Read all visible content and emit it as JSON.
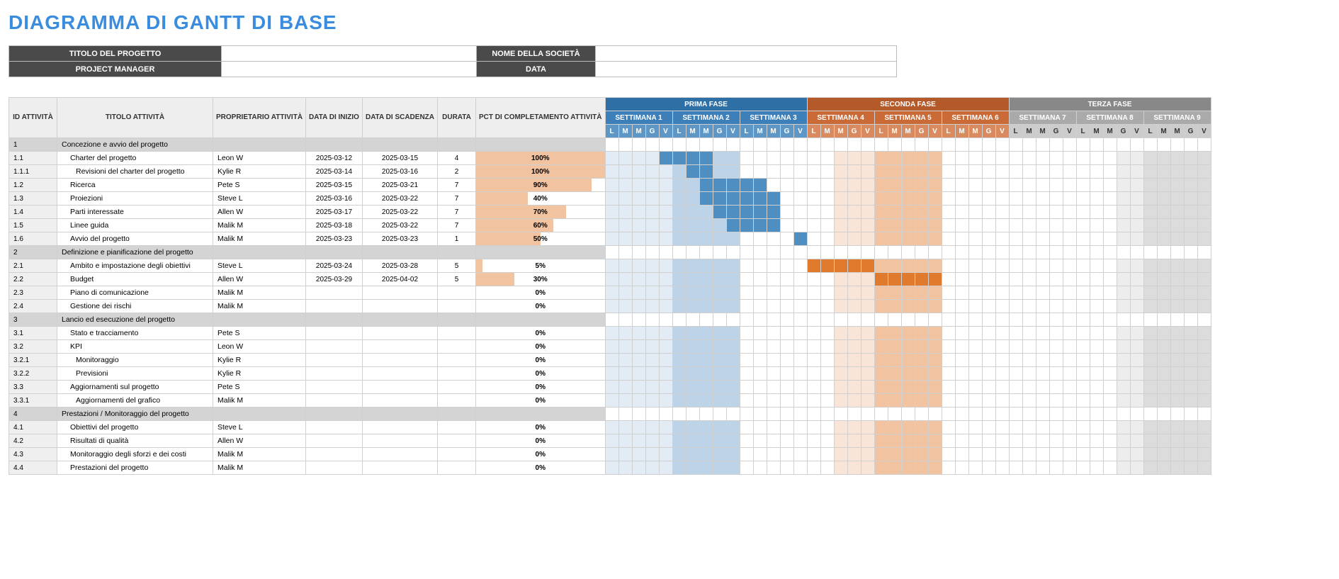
{
  "title": "DIAGRAMMA DI GANTT DI BASE",
  "info": {
    "project_title_lbl": "TITOLO DEL PROGETTO",
    "project_title_val": "",
    "company_lbl": "NOME DELLA SOCIETÀ",
    "company_val": "",
    "pm_lbl": "PROJECT MANAGER",
    "pm_val": "",
    "date_lbl": "DATA",
    "date_val": ""
  },
  "headers": {
    "id": "ID ATTIVITÀ",
    "task": "TITOLO ATTIVITÀ",
    "owner": "PROPRIETARIO ATTIVITÀ",
    "start": "DATA DI INIZIO",
    "end": "DATA DI SCADENZA",
    "duration": "DURATA",
    "pct": "PCT DI COMPLETAMENTO ATTIVITÀ"
  },
  "phases": [
    "PRIMA FASE",
    "SECONDA FASE",
    "TERZA FASE"
  ],
  "weeks": [
    "SETTIMANA 1",
    "SETTIMANA 2",
    "SETTIMANA 3",
    "SETTIMANA 4",
    "SETTIMANA 5",
    "SETTIMANA 6",
    "SETTIMANA 7",
    "SETTIMANA 8",
    "SETTIMANA 9"
  ],
  "days": [
    "L",
    "M",
    "M",
    "G",
    "V"
  ],
  "chart_data": {
    "type": "table",
    "rows": [
      {
        "id": "1",
        "section": true,
        "title": "Concezione e avvio del progetto"
      },
      {
        "id": "1.1",
        "title": "Charter del progetto",
        "indent": 1,
        "owner": "Leon W",
        "start": "2025-03-12",
        "end": "2025-03-15",
        "dur": 4,
        "pct": 100,
        "bar_start": 5,
        "bar_end": 8
      },
      {
        "id": "1.1.1",
        "title": "Revisioni del charter del progetto",
        "indent": 2,
        "owner": "Kylie R",
        "start": "2025-03-14",
        "end": "2025-03-16",
        "dur": 2,
        "pct": 100,
        "bar_start": 7,
        "bar_end": 8
      },
      {
        "id": "1.2",
        "title": "Ricerca",
        "indent": 1,
        "owner": "Pete S",
        "start": "2025-03-15",
        "end": "2025-03-21",
        "dur": 7,
        "pct": 90,
        "bar_start": 8,
        "bar_end": 12
      },
      {
        "id": "1.3",
        "title": "Proiezioni",
        "indent": 1,
        "owner": "Steve L",
        "start": "2025-03-16",
        "end": "2025-03-22",
        "dur": 7,
        "pct": 40,
        "bar_start": 8,
        "bar_end": 13
      },
      {
        "id": "1.4",
        "title": "Parti interessate",
        "indent": 1,
        "owner": "Allen W",
        "start": "2025-03-17",
        "end": "2025-03-22",
        "dur": 7,
        "pct": 70,
        "bar_start": 9,
        "bar_end": 13
      },
      {
        "id": "1.5",
        "title": "Linee guida",
        "indent": 1,
        "owner": "Malik M",
        "start": "2025-03-18",
        "end": "2025-03-22",
        "dur": 7,
        "pct": 60,
        "bar_start": 10,
        "bar_end": 13
      },
      {
        "id": "1.6",
        "title": "Avvio del progetto",
        "indent": 1,
        "owner": "Malik M",
        "start": "2025-03-23",
        "end": "2025-03-23",
        "dur": 1,
        "pct": 50,
        "bar_start": 15,
        "bar_end": 15
      },
      {
        "id": "2",
        "section": true,
        "title": "Definizione e pianificazione del progetto"
      },
      {
        "id": "2.1",
        "title": "Ambito e impostazione degli obiettivi",
        "indent": 1,
        "owner": "Steve L",
        "start": "2025-03-24",
        "end": "2025-03-28",
        "dur": 5,
        "pct": 5,
        "bar_start": 16,
        "bar_end": 20
      },
      {
        "id": "2.2",
        "title": "Budget",
        "indent": 1,
        "owner": "Allen W",
        "start": "2025-03-29",
        "end": "2025-04-02",
        "dur": 5,
        "pct": 30,
        "bar_start": 21,
        "bar_end": 25
      },
      {
        "id": "2.3",
        "title": "Piano di comunicazione",
        "indent": 1,
        "owner": "Malik M",
        "pct": 0
      },
      {
        "id": "2.4",
        "title": "Gestione dei rischi",
        "indent": 1,
        "owner": "Malik M",
        "pct": 0
      },
      {
        "id": "3",
        "section": true,
        "title": "Lancio ed esecuzione del progetto"
      },
      {
        "id": "3.1",
        "title": "Stato e tracciamento",
        "indent": 1,
        "owner": "Pete S",
        "pct": 0
      },
      {
        "id": "3.2",
        "title": "KPI",
        "indent": 1,
        "owner": "Leon W",
        "pct": 0
      },
      {
        "id": "3.2.1",
        "title": "Monitoraggio",
        "indent": 2,
        "owner": "Kylie R",
        "pct": 0
      },
      {
        "id": "3.2.2",
        "title": "Previsioni",
        "indent": 2,
        "owner": "Kylie R",
        "pct": 0
      },
      {
        "id": "3.3",
        "title": "Aggiornamenti sul progetto",
        "indent": 1,
        "owner": "Pete S",
        "pct": 0
      },
      {
        "id": "3.3.1",
        "title": "Aggiornamenti del grafico",
        "indent": 2,
        "owner": "Malik M",
        "pct": 0
      },
      {
        "id": "4",
        "section": true,
        "title": "Prestazioni / Monitoraggio del progetto"
      },
      {
        "id": "4.1",
        "title": "Obiettivi del progetto",
        "indent": 1,
        "owner": "Steve L",
        "pct": 0
      },
      {
        "id": "4.2",
        "title": "Risultati di qualità",
        "indent": 1,
        "owner": "Allen W",
        "pct": 0
      },
      {
        "id": "4.3",
        "title": "Monitoraggio degli sforzi e dei costi",
        "indent": 1,
        "owner": "Malik M",
        "pct": 0
      },
      {
        "id": "4.4",
        "title": "Prestazioni del progetto",
        "indent": 1,
        "owner": "Malik M",
        "pct": 0
      }
    ],
    "day_shade_map": {
      "light": {
        "1": [
          1,
          2,
          3,
          4,
          5,
          30
        ],
        "2": [
          18,
          19,
          20
        ],
        "3": [
          39,
          40
        ]
      },
      "medium": {
        "1": [
          6,
          7,
          8,
          9,
          10,
          31
        ],
        "2": [
          21,
          22,
          23,
          24,
          25
        ],
        "3": [
          41,
          42,
          43,
          44,
          45
        ]
      }
    }
  }
}
